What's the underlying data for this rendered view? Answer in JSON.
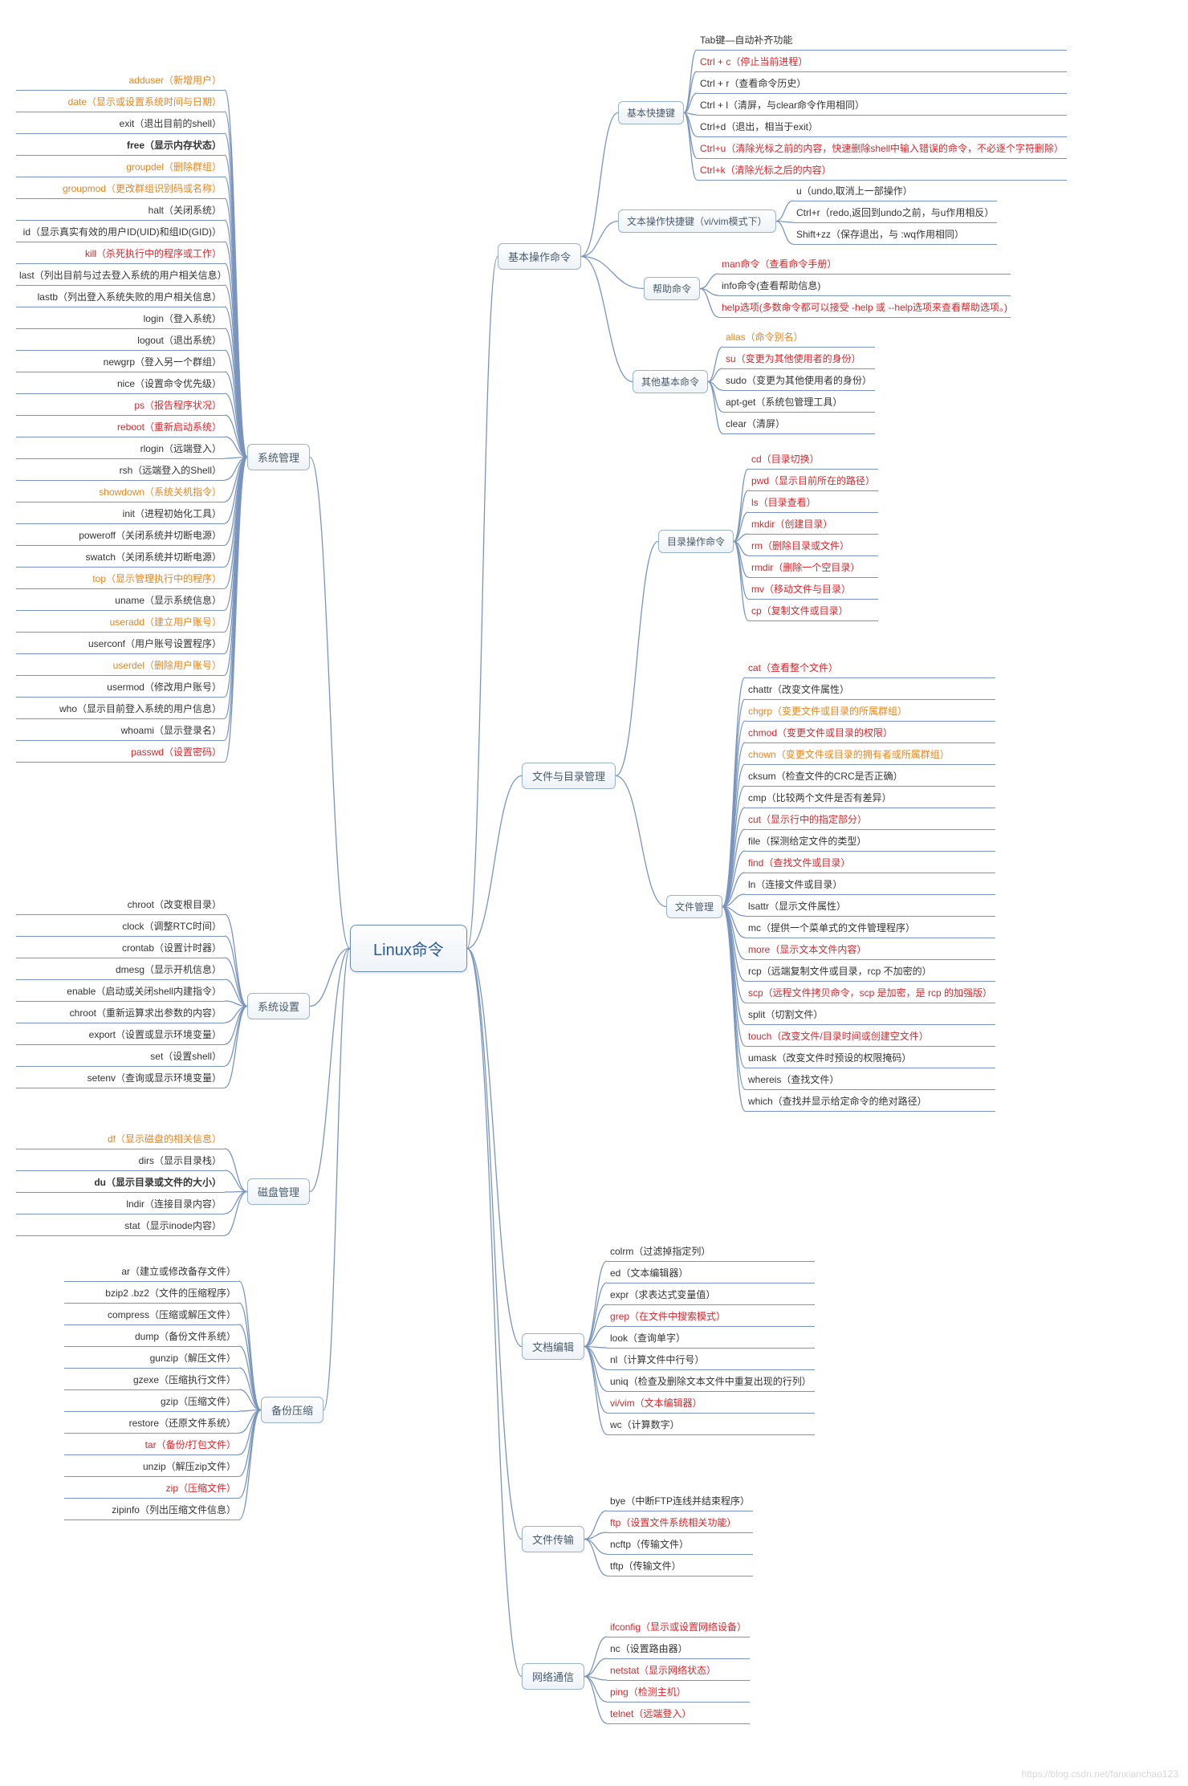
{
  "root": "Linux命令",
  "left": {
    "sysmgmt": {
      "label": "系统管理",
      "items": [
        {
          "t": "adduser（新增用户）",
          "c": "orange"
        },
        {
          "t": "date（显示或设置系统时间与日期）",
          "c": "orange"
        },
        {
          "t": "exit（退出目前的shell）"
        },
        {
          "t": "free（显示内存状态）",
          "c": "bold"
        },
        {
          "t": "groupdel（删除群组）",
          "c": "orange"
        },
        {
          "t": "groupmod（更改群组识别码或名称）",
          "c": "orange"
        },
        {
          "t": "halt（关闭系统）"
        },
        {
          "t": "id（显示真实有效的用户ID(UID)和组ID(GID)）"
        },
        {
          "t": "kill（杀死执行中的程序或工作）",
          "c": "red"
        },
        {
          "t": "last（列出目前与过去登入系统的用户相关信息）"
        },
        {
          "t": "lastb（列出登入系统失败的用户相关信息）"
        },
        {
          "t": "login（登入系统）"
        },
        {
          "t": "logout（退出系统）"
        },
        {
          "t": "newgrp（登入另一个群组）"
        },
        {
          "t": "nice（设置命令优先级）"
        },
        {
          "t": "ps（报告程序状况）",
          "c": "red"
        },
        {
          "t": "reboot（重新启动系统）",
          "c": "red"
        },
        {
          "t": "rlogin（远端登入）"
        },
        {
          "t": "rsh（远端登入的Shell）"
        },
        {
          "t": "showdown（系统关机指令）",
          "c": "orange"
        },
        {
          "t": "init（进程初始化工具）"
        },
        {
          "t": "poweroff（关闭系统并切断电源）"
        },
        {
          "t": "swatch（关闭系统并切断电源）"
        },
        {
          "t": "top（显示管理执行中的程序）",
          "c": "orange"
        },
        {
          "t": "uname（显示系统信息）"
        },
        {
          "t": "useradd（建立用户账号）",
          "c": "orange"
        },
        {
          "t": "userconf（用户账号设置程序）"
        },
        {
          "t": "userdel（删除用户账号）",
          "c": "orange"
        },
        {
          "t": "usermod（修改用户账号）"
        },
        {
          "t": "who（显示目前登入系统的用户信息）"
        },
        {
          "t": "whoami（显示登录名）"
        },
        {
          "t": "passwd（设置密码）",
          "c": "red"
        }
      ]
    },
    "sysset": {
      "label": "系统设置",
      "items": [
        {
          "t": "chroot（改变根目录）"
        },
        {
          "t": "clock（调整RTC时间）"
        },
        {
          "t": "crontab（设置计时器）"
        },
        {
          "t": "dmesg（显示开机信息）"
        },
        {
          "t": "enable（启动或关闭shell内建指令）"
        },
        {
          "t": "chroot（重新运算求出参数的内容）"
        },
        {
          "t": "export（设置或显示环境变量）"
        },
        {
          "t": "set（设置shell）"
        },
        {
          "t": "setenv（查询或显示环境变量）"
        }
      ]
    },
    "disk": {
      "label": "磁盘管理",
      "items": [
        {
          "t": "df（显示磁盘的相关信息）",
          "c": "orange"
        },
        {
          "t": "dirs（显示目录栈）"
        },
        {
          "t": "du（显示目录或文件的大小）",
          "c": "bold"
        },
        {
          "t": "lndir（连接目录内容）"
        },
        {
          "t": "stat（显示inode内容）"
        }
      ]
    },
    "backup": {
      "label": "备份压缩",
      "items": [
        {
          "t": "ar（建立或修改备存文件）"
        },
        {
          "t": "bzip2 .bz2（文件的压缩程序）"
        },
        {
          "t": "compress（压缩或解压文件）"
        },
        {
          "t": "dump（备份文件系统）"
        },
        {
          "t": "gunzip（解压文件）"
        },
        {
          "t": "gzexe（压缩执行文件）"
        },
        {
          "t": "gzip（压缩文件）"
        },
        {
          "t": "restore（还原文件系统）"
        },
        {
          "t": "tar（备份/打包文件）",
          "c": "red"
        },
        {
          "t": "unzip（解压zip文件）"
        },
        {
          "t": "zip（压缩文件）",
          "c": "red"
        },
        {
          "t": "zipinfo（列出压缩文件信息）"
        }
      ]
    }
  },
  "right": {
    "basicop": {
      "label": "基本操作命令",
      "children": {
        "shortcut": {
          "label": "基本快捷键",
          "items": [
            {
              "t": "Tab键—自动补齐功能"
            },
            {
              "t": "Ctrl + c（停止当前进程）",
              "c": "red"
            },
            {
              "t": "Ctrl + r（查看命令历史）"
            },
            {
              "t": "Ctrl + l（清屏，与clear命令作用相同）"
            },
            {
              "t": "Ctrl+d（退出，相当于exit）"
            },
            {
              "t": "Ctrl+u（清除光标之前的内容，快速删除shell中输入错误的命令，不必逐个字符删除）",
              "c": "red"
            },
            {
              "t": "Ctrl+k（清除光标之后的内容）",
              "c": "red"
            }
          ]
        },
        "textop": {
          "label": "文本操作快捷键（vi/vim模式下）",
          "items": [
            {
              "t": "u（undo,取消上一部操作）"
            },
            {
              "t": "Ctrl+r（redo,返回到undo之前，与u作用相反）"
            },
            {
              "t": "Shift+zz（保存退出，与 :wq作用相同）"
            }
          ]
        },
        "help": {
          "label": "帮助命令",
          "items": [
            {
              "t": "man命令（查看命令手册）",
              "c": "red"
            },
            {
              "t": "info命令(查看帮助信息)"
            },
            {
              "t": "help选项(多数命令都可以接受 -help 或 --help选项来查看帮助选项。)",
              "c": "red"
            }
          ]
        },
        "otherbasic": {
          "label": "其他基本命令",
          "items": [
            {
              "t": "alias（命令别名）",
              "c": "orange"
            },
            {
              "t": "su（变更为其他使用者的身份）",
              "c": "red"
            },
            {
              "t": "sudo（变更为其他使用者的身份）"
            },
            {
              "t": "apt-get（系统包管理工具）"
            },
            {
              "t": "clear（清屏）"
            }
          ]
        }
      }
    },
    "filedir": {
      "label": "文件与目录管理",
      "children": {
        "dirop": {
          "label": "目录操作命令",
          "items": [
            {
              "t": "cd（目录切换）",
              "c": "red"
            },
            {
              "t": "pwd（显示目前所在的路径）",
              "c": "red"
            },
            {
              "t": "ls（目录查看）",
              "c": "red"
            },
            {
              "t": "mkdir（创建目录）",
              "c": "red"
            },
            {
              "t": "rm（删除目录或文件）",
              "c": "red"
            },
            {
              "t": "rmdir（删除一个空目录）",
              "c": "red"
            },
            {
              "t": "mv（移动文件与目录）",
              "c": "red"
            },
            {
              "t": "cp（复制文件或目录）",
              "c": "red"
            }
          ]
        },
        "filemgmt": {
          "label": "文件管理",
          "items": [
            {
              "t": "cat（查看整个文件）",
              "c": "red"
            },
            {
              "t": "chattr（改变文件属性）"
            },
            {
              "t": "chgrp（变更文件或目录的所属群组）",
              "c": "orange"
            },
            {
              "t": "chmod（变更文件或目录的权限）",
              "c": "red"
            },
            {
              "t": "chown（变更文件或目录的拥有者或所属群组）",
              "c": "orange"
            },
            {
              "t": "cksum（检查文件的CRC是否正确）"
            },
            {
              "t": "cmp（比较两个文件是否有差异）"
            },
            {
              "t": "cut（显示行中的指定部分）",
              "c": "red"
            },
            {
              "t": "file（探测给定文件的类型）"
            },
            {
              "t": "find（查找文件或目录）",
              "c": "red"
            },
            {
              "t": "ln（连接文件或目录）"
            },
            {
              "t": "lsattr（显示文件属性）"
            },
            {
              "t": "mc（提供一个菜单式的文件管理程序）"
            },
            {
              "t": "more（显示文本文件内容）",
              "c": "red"
            },
            {
              "t": "rcp（远端复制文件或目录，rcp 不加密的）"
            },
            {
              "t": "scp（远程文件拷贝命令，scp 是加密，是 rcp 的加强版）",
              "c": "red"
            },
            {
              "t": "split（切割文件）"
            },
            {
              "t": "touch（改变文件/目录时间或创建空文件）",
              "c": "red"
            },
            {
              "t": "umask（改变文件时预设的权限掩码）"
            },
            {
              "t": "whereis（查找文件）"
            },
            {
              "t": "which（查找并显示给定命令的绝对路径）"
            }
          ]
        }
      }
    },
    "docedit": {
      "label": "文档编辑",
      "items": [
        {
          "t": "colrm（过滤掉指定列）"
        },
        {
          "t": "ed（文本编辑器）"
        },
        {
          "t": "expr（求表达式变量值）"
        },
        {
          "t": "grep（在文件中搜索模式）",
          "c": "red"
        },
        {
          "t": "look（查询单字）"
        },
        {
          "t": "nl（计算文件中行号）"
        },
        {
          "t": "uniq（检查及删除文本文件中重复出现的行列）"
        },
        {
          "t": "vi/vim（文本编辑器）",
          "c": "red"
        },
        {
          "t": "wc（计算数字）"
        }
      ]
    },
    "filetrans": {
      "label": "文件传输",
      "items": [
        {
          "t": "bye（中断FTP连线并结束程序）"
        },
        {
          "t": "ftp（设置文件系统相关功能）",
          "c": "red"
        },
        {
          "t": "ncftp（传输文件）"
        },
        {
          "t": "tftp（传输文件）"
        }
      ]
    },
    "netcomm": {
      "label": "网络通信",
      "items": [
        {
          "t": "ifconfig（显示或设置网络设备）",
          "c": "red"
        },
        {
          "t": "nc（设置路由器）"
        },
        {
          "t": "netstat（显示网络状态）",
          "c": "red"
        },
        {
          "t": "ping（检测主机）",
          "c": "red"
        },
        {
          "t": "telnet（远端登入）",
          "c": "red"
        }
      ]
    }
  },
  "watermark": "https://blog.csdn.net/fanxianchao123"
}
